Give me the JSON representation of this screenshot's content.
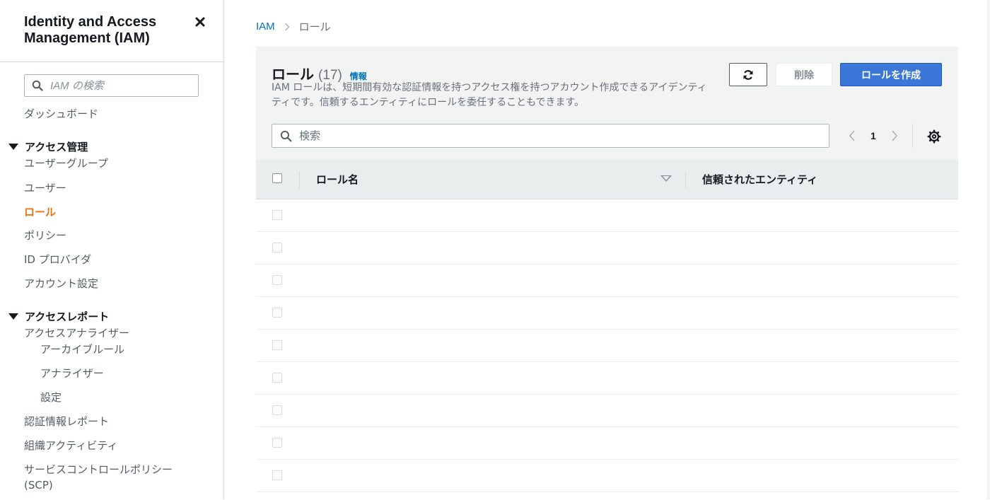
{
  "sidebar": {
    "title": "Identity and Access Management (IAM)",
    "search_placeholder": "IAM の検索",
    "dashboard": "ダッシュボード",
    "section_access": "アクセス管理",
    "access_items": [
      "ユーザーグループ",
      "ユーザー",
      "ロール",
      "ポリシー",
      "ID プロバイダ",
      "アカウント設定"
    ],
    "active_item": "ロール",
    "section_reports": "アクセスレポート",
    "analyzer": "アクセスアナライザー",
    "analyzer_items": [
      "アーカイブルール",
      "アナライザー",
      "設定"
    ],
    "report_items": [
      "認証情報レポート",
      "組織アクティビティ"
    ],
    "scp_line1": "サービスコントロールポリシー",
    "scp_line2": "(SCP)"
  },
  "breadcrumb": {
    "root": "IAM",
    "current": "ロール"
  },
  "panel": {
    "title": "ロール",
    "count": "(17)",
    "info_link": "情報",
    "description": "IAM ロールは、短期間有効な認証情報を持つアクセス権を持つアカウント作成できるアイデンティティです。信頼するエンティティにロールを委任することもできます。",
    "delete_label": "削除",
    "create_label": "ロールを作成",
    "search_placeholder": "検索",
    "page_number": "1"
  },
  "table": {
    "columns": [
      "ロール名",
      "信頼されたエンティティ"
    ],
    "rows": [
      "",
      "",
      "",
      "",
      "",
      "",
      "",
      "",
      ""
    ]
  },
  "colors": {
    "accent": "#ec7211",
    "link": "#0073bb",
    "primary_button": "#3b77d8"
  }
}
